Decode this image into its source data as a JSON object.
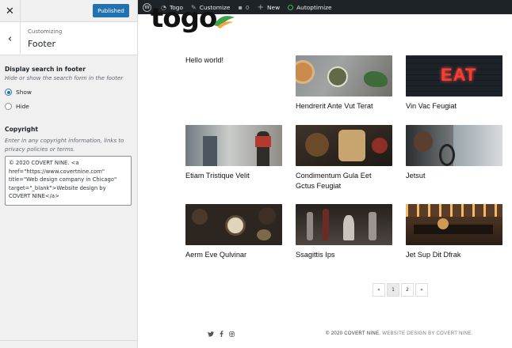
{
  "panel": {
    "publish_label": "Published",
    "section_kicker": "Customizing",
    "section_title": "Footer",
    "search_control": {
      "title": "Display search in footer",
      "description": "Hide or show the search form in the footer",
      "options": [
        {
          "label": "Show",
          "checked": true
        },
        {
          "label": "Hide",
          "checked": false
        }
      ]
    },
    "copyright_control": {
      "title": "Copyright",
      "description": "Enter in any copyright information, links to privacy policies or terms.",
      "value": "© 2020 COVERT NINE. <a href=\"https://www.covertnine.com\" title=\"Web design company in Chicago\" target=\"_blank\">Website design by COVERT NINE</a>"
    }
  },
  "adminbar": {
    "site": "Togo",
    "customize": "Customize",
    "comments": "0",
    "new": "New",
    "autoptimize": "Autoptimize"
  },
  "site": {
    "logo": "togo",
    "accent": "#3fa34d"
  },
  "posts": [
    {
      "title": "Hello world!",
      "has_image": false
    },
    {
      "title": "Hendrerit Ante Vut Terat",
      "has_image": true
    },
    {
      "title": "Vin Vac Feugiat",
      "has_image": true
    },
    {
      "title": "Etiam Tristique Velit",
      "has_image": true
    },
    {
      "title": "Condimentum Gula Eet Gctus Feugiat",
      "has_image": true
    },
    {
      "title": "Jetsut",
      "has_image": true
    },
    {
      "title": "Aerm Eve Qulvinar",
      "has_image": true
    },
    {
      "title": "Ssagittis Ips",
      "has_image": true
    },
    {
      "title": "Jet Sup Dit Dfrak",
      "has_image": true
    }
  ],
  "pagination": {
    "prev": "«",
    "pages": [
      "1",
      "2"
    ],
    "current": "1",
    "next": "»"
  },
  "footer": {
    "copyright_main": "© 2020 COVERT NINE.",
    "copyright_link": "WEBSITE DESIGN BY COVERT NINE."
  }
}
